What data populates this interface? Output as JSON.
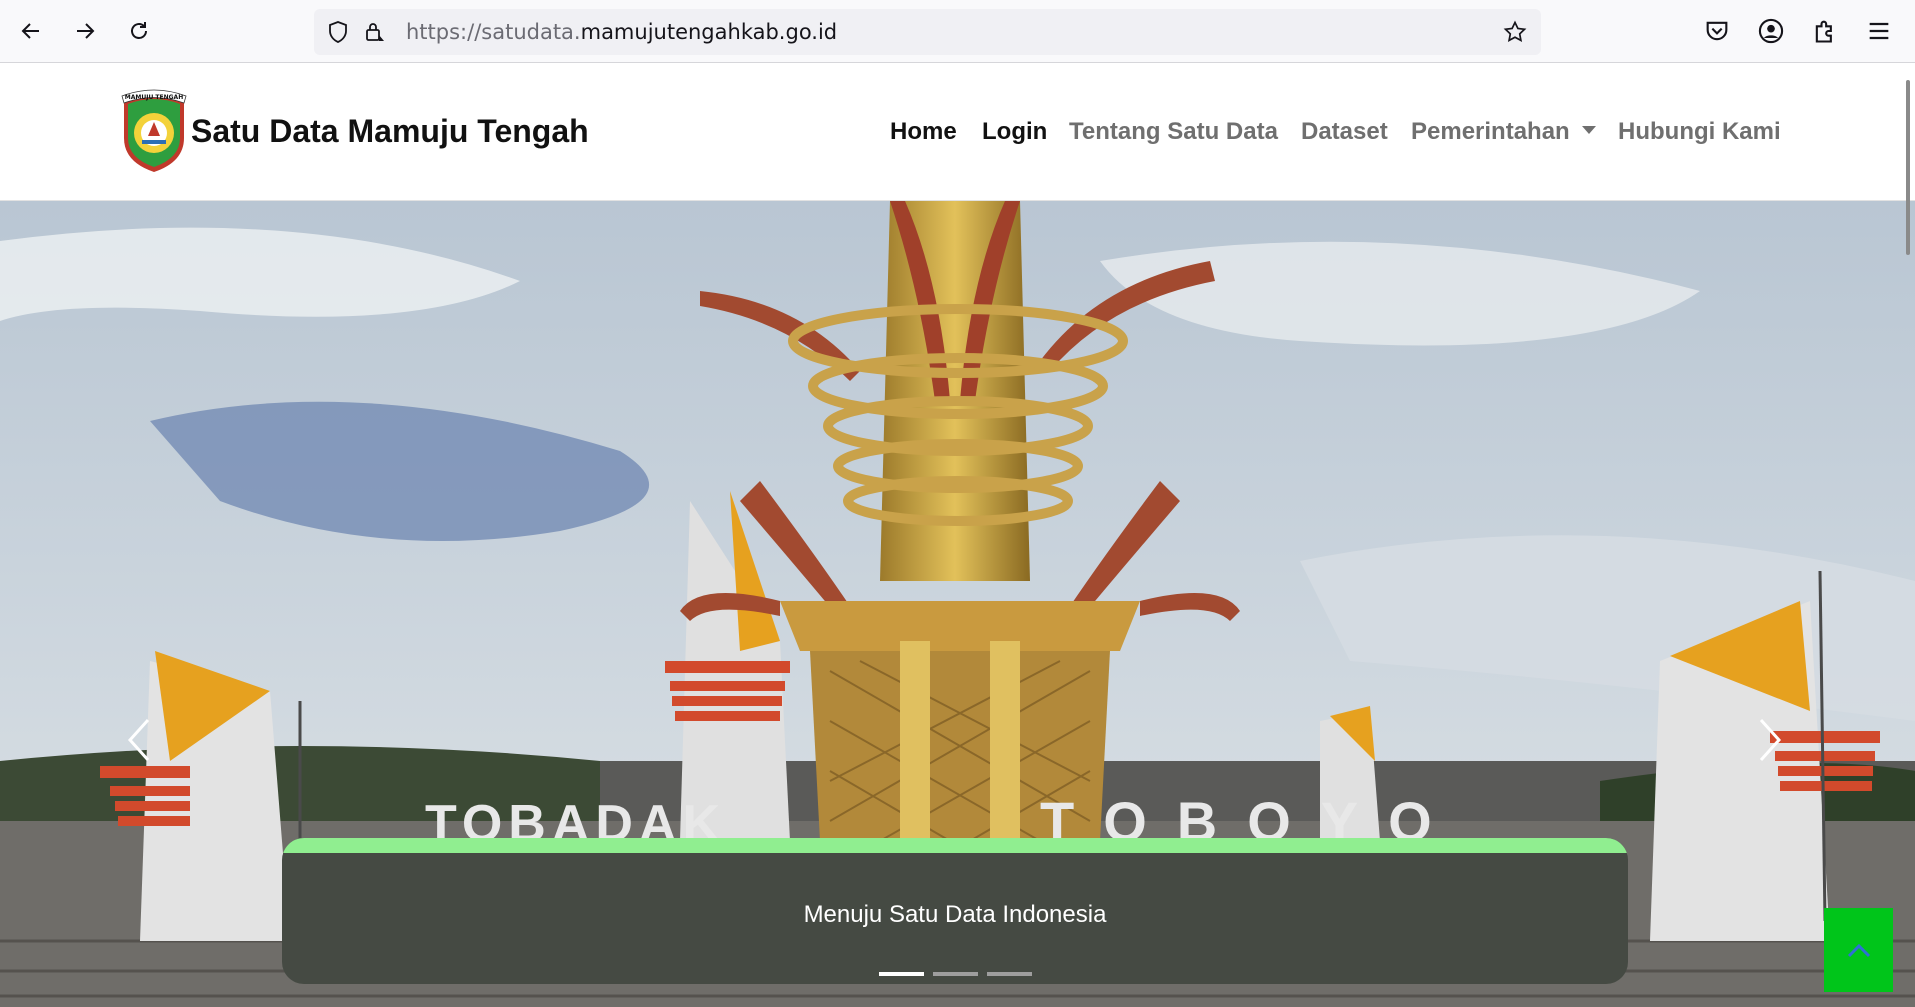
{
  "browser": {
    "url_prefix": "https://satudata.",
    "url_domain": "mamujutengahkab.go.id",
    "icons": [
      "back-arrow-icon",
      "forward-arrow-icon",
      "reload-icon",
      "shield-icon",
      "lock-icon",
      "star-icon",
      "pocket-icon",
      "account-icon",
      "extensions-icon",
      "menu-icon"
    ]
  },
  "header": {
    "logo_text": "MAMUJU TENGAH",
    "brand": "Satu Data Mamuju Tengah",
    "nav": {
      "home": "Home",
      "login": "Login",
      "about": "Tentang Satu Data",
      "dataset": "Dataset",
      "government": "Pemerintahan",
      "contact": "Hubungi Kami"
    }
  },
  "hero": {
    "caption": "Menuju Satu Data Indonesia",
    "slide_count": 3,
    "active_slide": 1,
    "monument_text_left": "TOBADAK",
    "monument_text_right": "TOBOYO"
  },
  "colors": {
    "caption_bg": "#454a43",
    "caption_accent": "#90ee90",
    "back_to_top": "#00c51a"
  }
}
